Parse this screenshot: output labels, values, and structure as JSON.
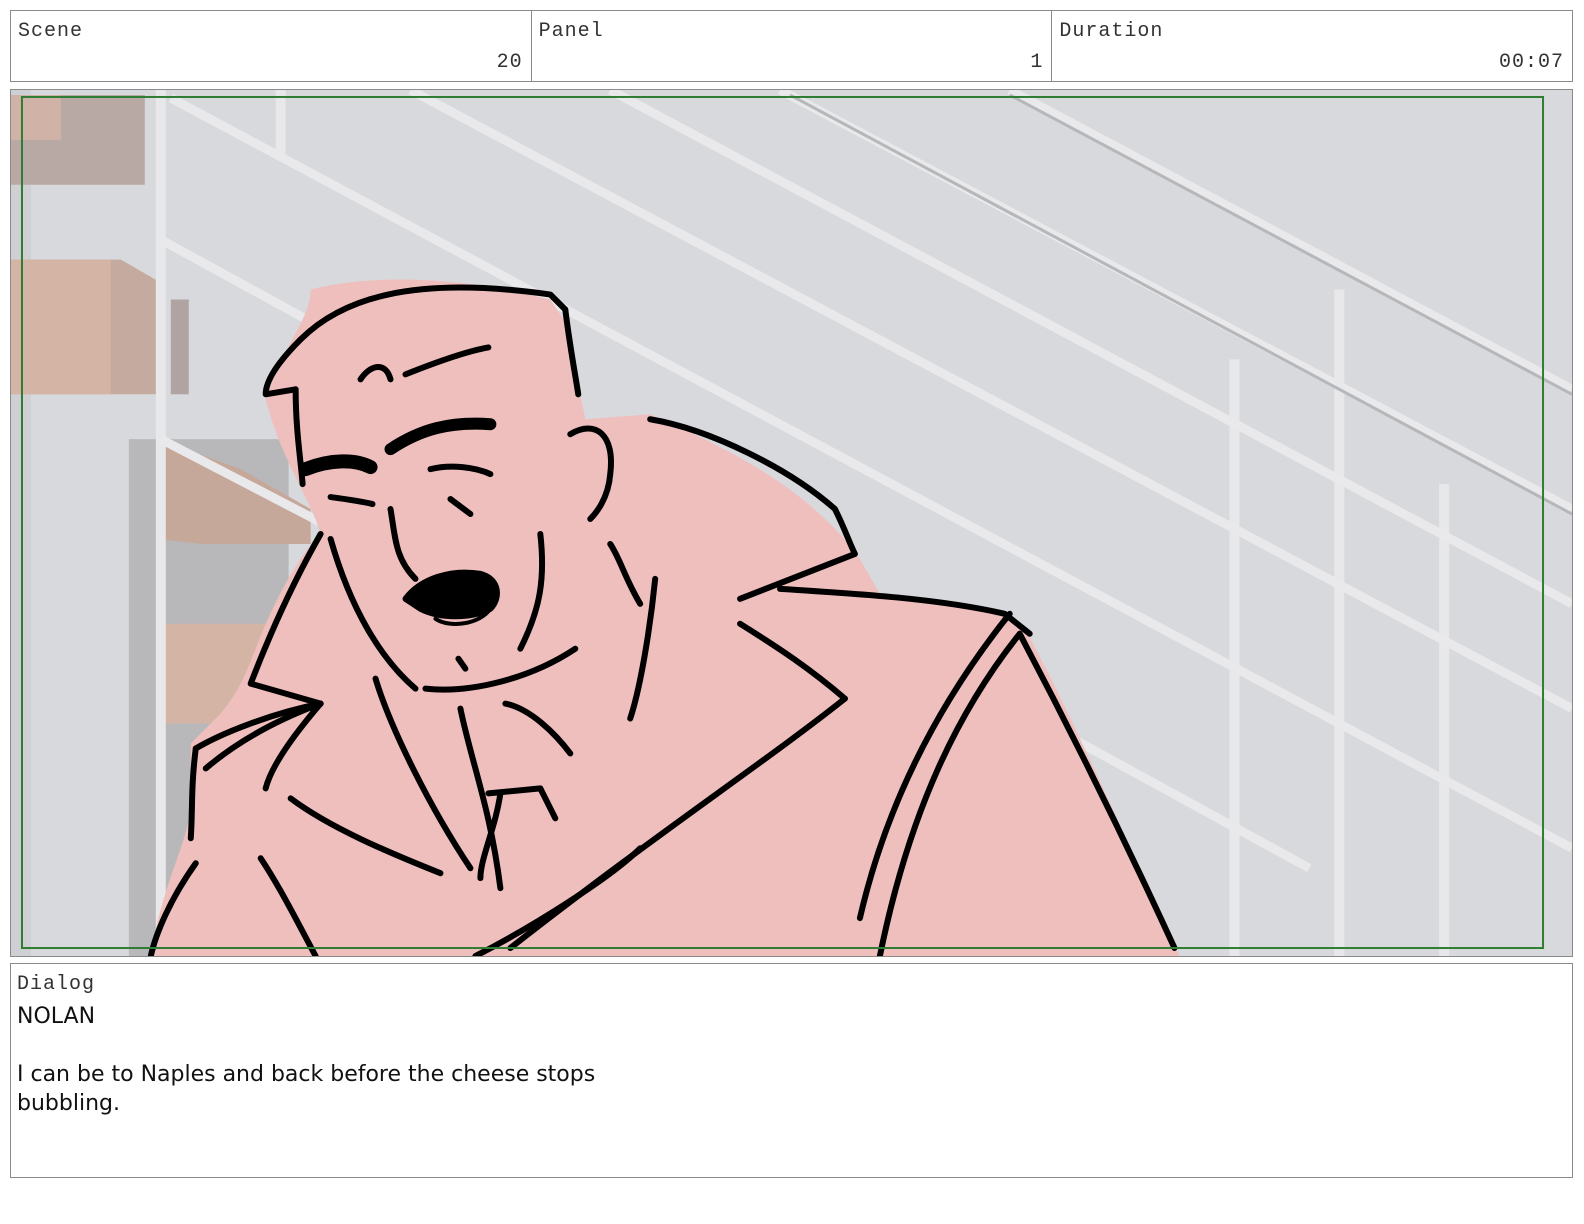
{
  "header": {
    "scene": {
      "label": "Scene",
      "value": "20"
    },
    "panel": {
      "label": "Panel",
      "value": "1"
    },
    "duration": {
      "label": "Duration",
      "value": "00:07"
    }
  },
  "dialog": {
    "label": "Dialog",
    "speaker": "NOLAN",
    "text": "I can be to Naples and back before the cheese stops bubbling."
  },
  "colors": {
    "frame_guide": "#2e7d32",
    "character_fill": "#efbfbe",
    "background": "#d6d7da",
    "ink": "#000000"
  }
}
